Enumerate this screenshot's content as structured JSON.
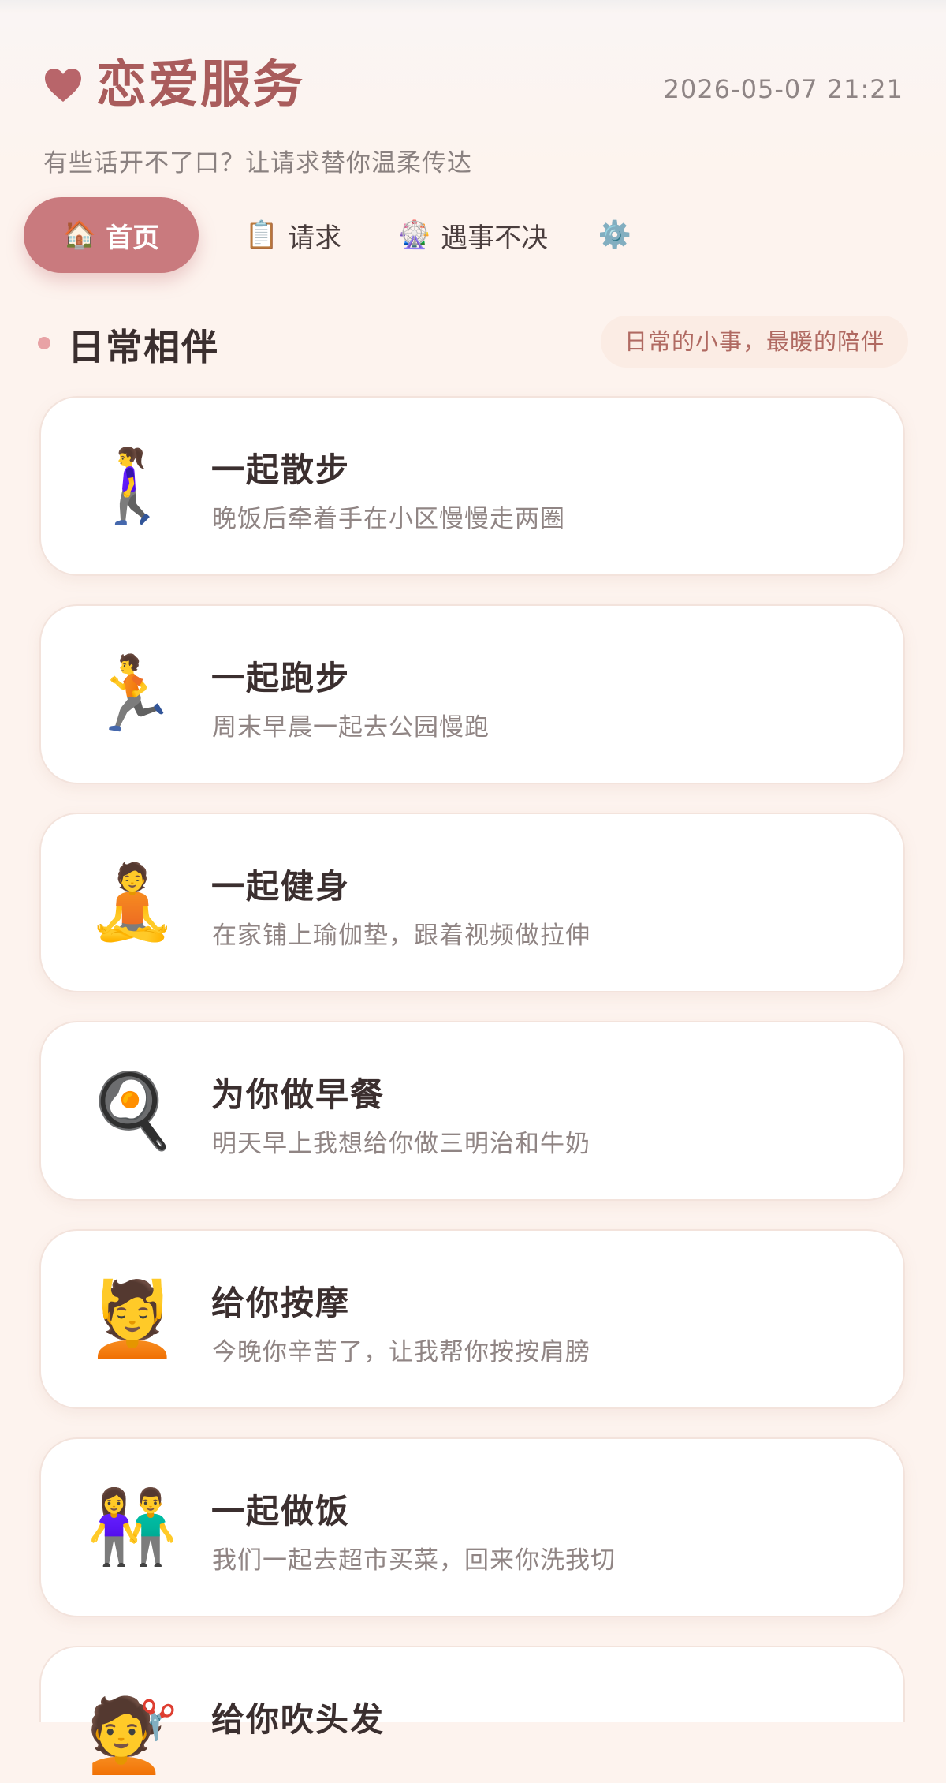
{
  "header": {
    "title": "恋爱服务",
    "datetime": "2026-05-07 21:21",
    "subtitle": "有些话开不了口？让请求替你温柔传达",
    "accent_color": "#a95c5c"
  },
  "tabs": [
    {
      "label": "首页",
      "icon": "🏠",
      "icon_name": "house-icon",
      "active": true
    },
    {
      "label": "请求",
      "icon": "📋",
      "icon_name": "clipboard-icon",
      "active": false
    },
    {
      "label": "遇事不决",
      "icon": "🎡",
      "icon_name": "ferris-wheel-icon",
      "active": false
    },
    {
      "label": "",
      "icon": "⚙️",
      "icon_name": "gear-icon",
      "active": false
    }
  ],
  "section": {
    "title": "日常相伴",
    "tagline": "日常的小事，最暖的陪伴"
  },
  "cards": [
    {
      "emoji": "🚶‍♀️",
      "icon_name": "person-walking-icon",
      "title": "一起散步",
      "desc": "晚饭后牵着手在小区慢慢走两圈"
    },
    {
      "emoji": "🏃",
      "icon_name": "person-running-icon",
      "title": "一起跑步",
      "desc": "周末早晨一起去公园慢跑"
    },
    {
      "emoji": "🧘",
      "icon_name": "person-yoga-icon",
      "title": "一起健身",
      "desc": "在家铺上瑜伽垫，跟着视频做拉伸"
    },
    {
      "emoji": "🍳",
      "icon_name": "frying-pan-egg-icon",
      "title": "为你做早餐",
      "desc": "明天早上我想给你做三明治和牛奶"
    },
    {
      "emoji": "💆",
      "icon_name": "person-massage-icon",
      "title": "给你按摩",
      "desc": "今晚你辛苦了，让我帮你按按肩膀"
    },
    {
      "emoji": "👫",
      "icon_name": "couple-holding-hands-icon",
      "title": "一起做饭",
      "desc": "我们一起去超市买菜，回来你洗我切"
    },
    {
      "emoji": "💇",
      "icon_name": "haircut-icon",
      "title": "给你吹头发",
      "desc": ""
    }
  ],
  "colors": {
    "background": "#fdf3ee",
    "active_tab": "#c97a7e",
    "section_dot": "#e8a2a5",
    "tagline_text": "#b06a62"
  }
}
